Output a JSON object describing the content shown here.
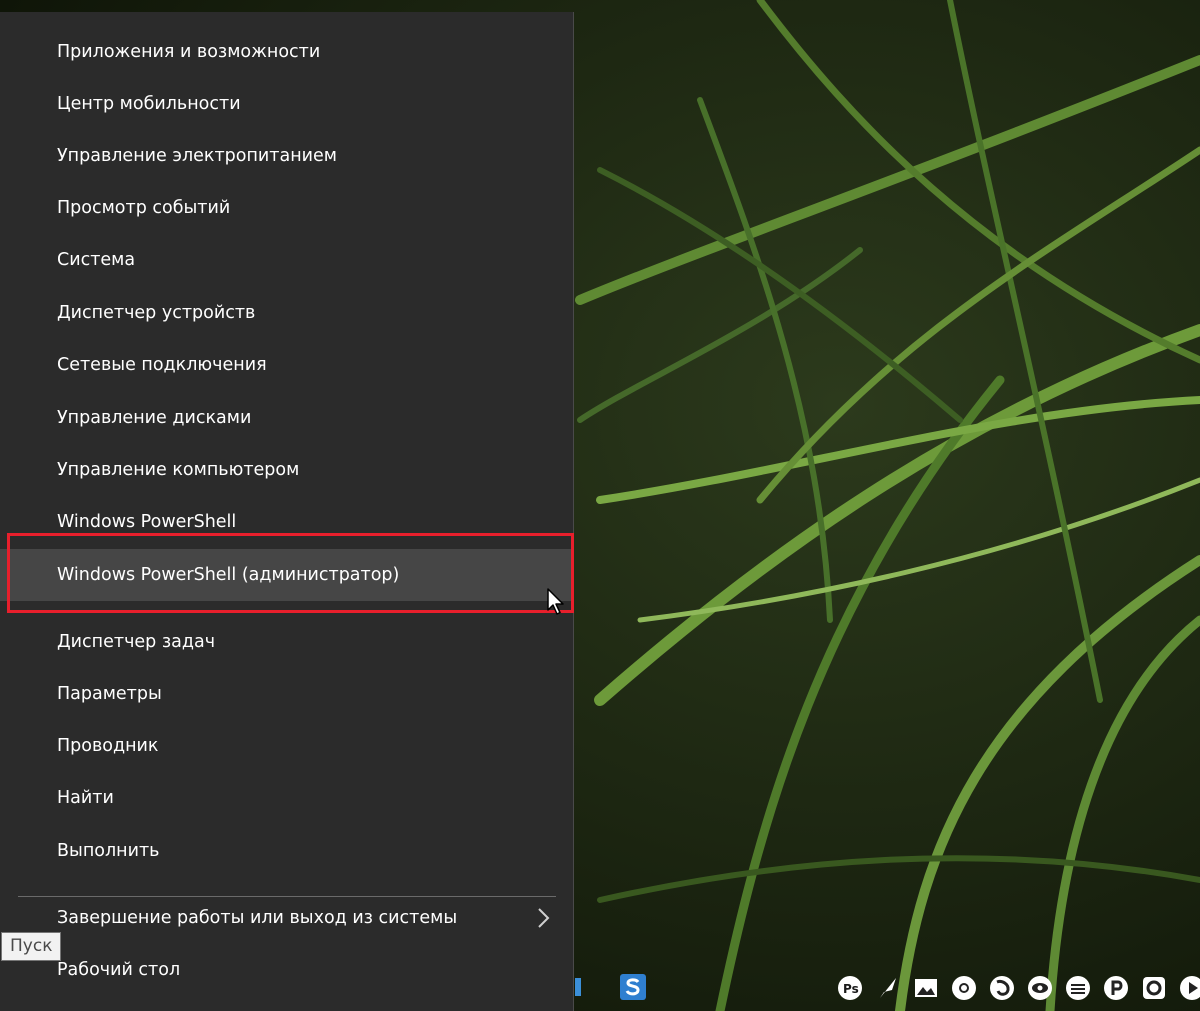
{
  "menu": {
    "items": [
      {
        "label": "Приложения и возможности"
      },
      {
        "label": "Центр мобильности"
      },
      {
        "label": "Управление электропитанием"
      },
      {
        "label": "Просмотр событий"
      },
      {
        "label": "Система"
      },
      {
        "label": "Диспетчер устройств"
      },
      {
        "label": "Сетевые подключения"
      },
      {
        "label": "Управление дисками"
      },
      {
        "label": "Управление компьютером"
      },
      {
        "label": "Windows PowerShell"
      },
      {
        "label": "Windows PowerShell (администратор)"
      },
      {
        "label": "Диспетчер задач"
      },
      {
        "label": "Параметры"
      },
      {
        "label": "Проводник"
      },
      {
        "label": "Найти"
      },
      {
        "label": "Выполнить"
      },
      {
        "label": "Завершение работы или выход из системы"
      },
      {
        "label": "Рабочий стол"
      }
    ],
    "hovered_label": "Windows PowerShell (администратор)"
  },
  "tooltip": {
    "text": "Пуск"
  },
  "colors": {
    "menu_bg": "#2b2b2b",
    "hover_bg": "#464646",
    "highlight_border": "#e81f2c",
    "menu_text": "#ffffff"
  },
  "tray": {
    "icons": [
      "photoshop-icon",
      "feather-icon",
      "image-viewer-icon",
      "chrome-icon",
      "firefox-icon",
      "eye-icon",
      "stack-icon",
      "p-icon",
      "o-icon",
      "play-icon"
    ]
  }
}
